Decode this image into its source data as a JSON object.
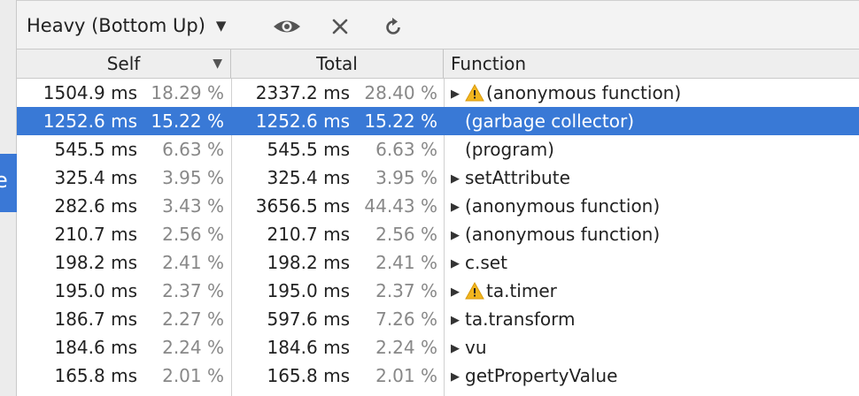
{
  "toolbar": {
    "view_label": "Heavy (Bottom Up)",
    "icons": [
      "eye-icon",
      "close-icon",
      "refresh-icon"
    ]
  },
  "left_tab": {
    "label": "e"
  },
  "header": {
    "self": "Self",
    "total": "Total",
    "function": "Function"
  },
  "rows": [
    {
      "self_ms": "1504.9 ms",
      "self_pct": "18.29 %",
      "total_ms": "2337.2 ms",
      "total_pct": "28.40 %",
      "func": "(anonymous function)",
      "expandable": true,
      "warning": true,
      "selected": false
    },
    {
      "self_ms": "1252.6 ms",
      "self_pct": "15.22 %",
      "total_ms": "1252.6 ms",
      "total_pct": "15.22 %",
      "func": "(garbage collector)",
      "expandable": false,
      "warning": false,
      "selected": true
    },
    {
      "self_ms": "545.5 ms",
      "self_pct": "6.63 %",
      "total_ms": "545.5 ms",
      "total_pct": "6.63 %",
      "func": "(program)",
      "expandable": false,
      "warning": false,
      "selected": false
    },
    {
      "self_ms": "325.4 ms",
      "self_pct": "3.95 %",
      "total_ms": "325.4 ms",
      "total_pct": "3.95 %",
      "func": "setAttribute",
      "expandable": true,
      "warning": false,
      "selected": false
    },
    {
      "self_ms": "282.6 ms",
      "self_pct": "3.43 %",
      "total_ms": "3656.5 ms",
      "total_pct": "44.43 %",
      "func": "(anonymous function)",
      "expandable": true,
      "warning": false,
      "selected": false
    },
    {
      "self_ms": "210.7 ms",
      "self_pct": "2.56 %",
      "total_ms": "210.7 ms",
      "total_pct": "2.56 %",
      "func": "(anonymous function)",
      "expandable": true,
      "warning": false,
      "selected": false
    },
    {
      "self_ms": "198.2 ms",
      "self_pct": "2.41 %",
      "total_ms": "198.2 ms",
      "total_pct": "2.41 %",
      "func": "c.set",
      "expandable": true,
      "warning": false,
      "selected": false
    },
    {
      "self_ms": "195.0 ms",
      "self_pct": "2.37 %",
      "total_ms": "195.0 ms",
      "total_pct": "2.37 %",
      "func": "ta.timer",
      "expandable": true,
      "warning": true,
      "selected": false
    },
    {
      "self_ms": "186.7 ms",
      "self_pct": "2.27 %",
      "total_ms": "597.6 ms",
      "total_pct": "7.26 %",
      "func": "ta.transform",
      "expandable": true,
      "warning": false,
      "selected": false
    },
    {
      "self_ms": "184.6 ms",
      "self_pct": "2.24 %",
      "total_ms": "184.6 ms",
      "total_pct": "2.24 %",
      "func": "vu",
      "expandable": true,
      "warning": false,
      "selected": false
    },
    {
      "self_ms": "165.8 ms",
      "self_pct": "2.01 %",
      "total_ms": "165.8 ms",
      "total_pct": "2.01 %",
      "func": "getPropertyValue",
      "expandable": true,
      "warning": false,
      "selected": false
    }
  ],
  "colors": {
    "selection": "#3979d6",
    "warning": "#f2b51e",
    "muted_pct": "#888888"
  }
}
